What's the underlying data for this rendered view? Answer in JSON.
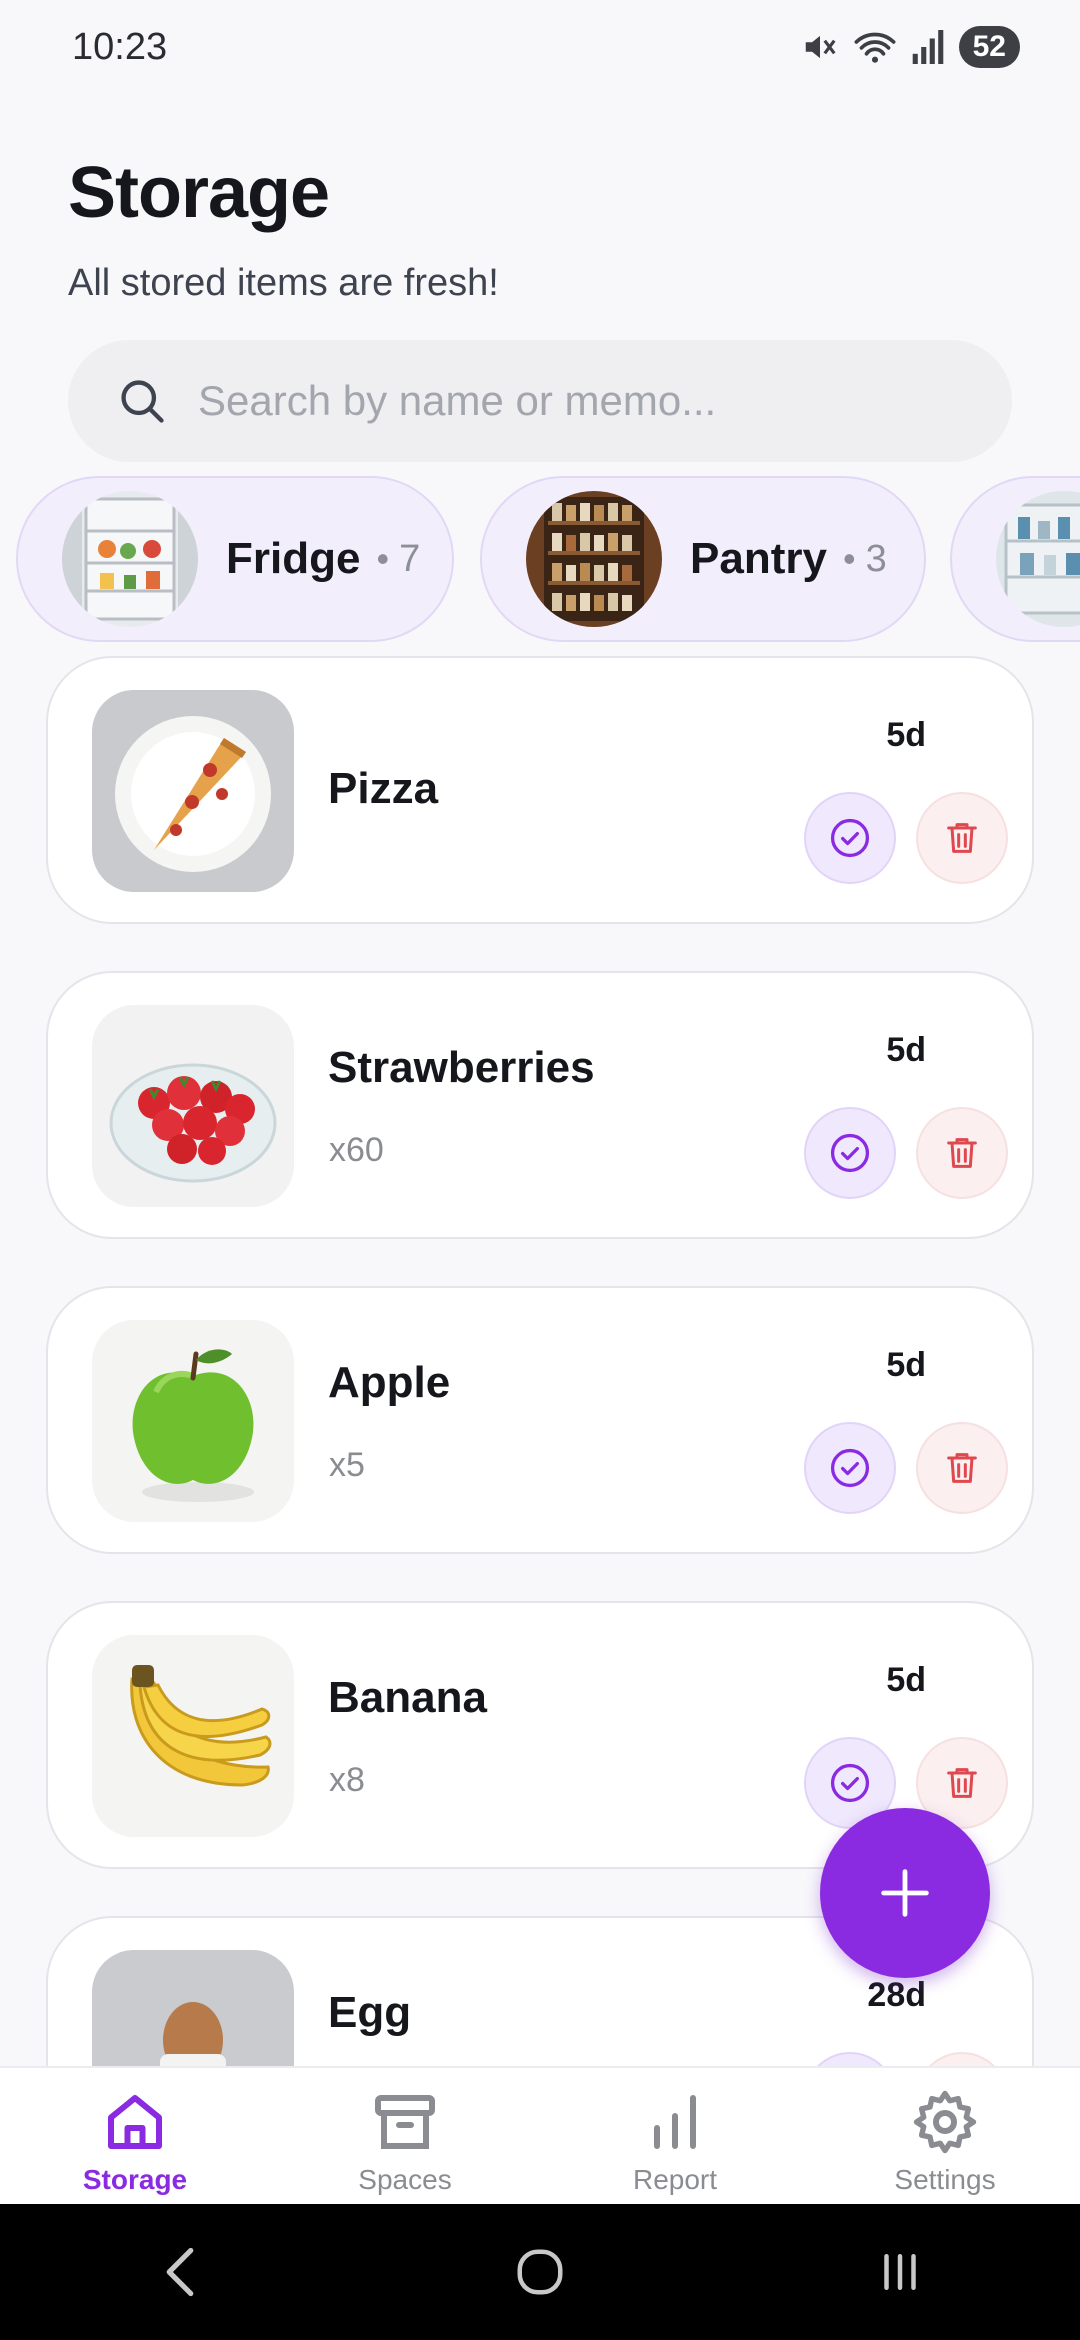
{
  "status_bar": {
    "time": "10:23",
    "battery": "52",
    "icons": [
      "mute-icon",
      "wifi-icon",
      "signal-icon",
      "battery-icon"
    ]
  },
  "header": {
    "title": "Storage",
    "subtitle": "All stored items are fresh!"
  },
  "search": {
    "placeholder": "Search by name or memo...",
    "value": ""
  },
  "spaces": [
    {
      "name": "Fridge",
      "count": "7"
    },
    {
      "name": "Pantry",
      "count": "3"
    },
    {
      "name": "",
      "count": ""
    }
  ],
  "items": [
    {
      "name": "Pizza",
      "qty": "",
      "days": "5d"
    },
    {
      "name": "Strawberries",
      "qty": "x60",
      "days": "5d"
    },
    {
      "name": "Apple",
      "qty": "x5",
      "days": "5d"
    },
    {
      "name": "Banana",
      "qty": "x8",
      "days": "5d"
    },
    {
      "name": "Egg",
      "qty": "",
      "days": "28d"
    }
  ],
  "nav": {
    "items": [
      {
        "label": "Storage",
        "icon": "home-icon",
        "active": true
      },
      {
        "label": "Spaces",
        "icon": "archive-icon",
        "active": false
      },
      {
        "label": "Report",
        "icon": "bar-chart-icon",
        "active": false
      },
      {
        "label": "Settings",
        "icon": "gear-icon",
        "active": false
      }
    ]
  },
  "colors": {
    "accent": "#8a2be2",
    "danger": "#e0484f",
    "background": "#f8f8fb"
  }
}
